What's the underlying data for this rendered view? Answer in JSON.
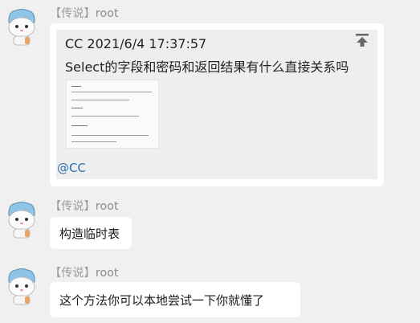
{
  "messages": [
    {
      "sender_tag": "【传说】",
      "sender_name": "root",
      "quote": {
        "header": "CC  2021/6/4 17:37:57",
        "text": "Select的字段和密码和返回结果有什么直接关系吗",
        "mention": "@CC"
      }
    },
    {
      "sender_tag": "【传说】",
      "sender_name": "root",
      "text": "构造临时表"
    },
    {
      "sender_tag": "【传说】",
      "sender_name": "root",
      "text": "这个方法你可以本地尝试一下你就懂了"
    }
  ],
  "icons": {
    "avatar": "cat-avatar-icon",
    "pin": "pin-top-icon"
  },
  "colors": {
    "background": "#f0f0f0",
    "bubble": "#ffffff",
    "quote_bg": "#eeeeee",
    "sender": "#8c8c8c",
    "mention": "#2f6fb3"
  }
}
